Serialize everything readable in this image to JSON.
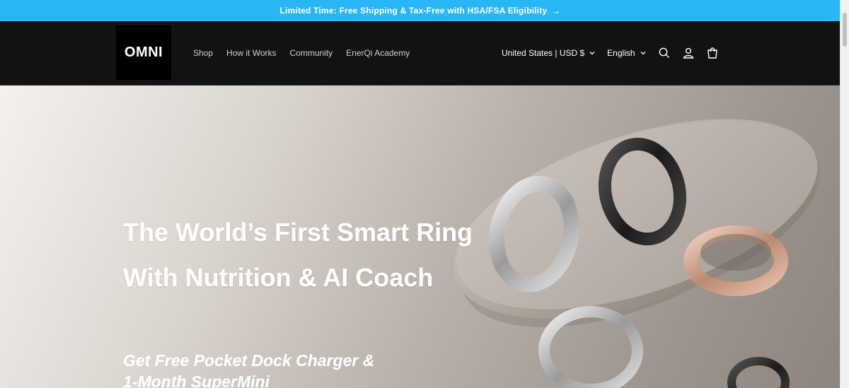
{
  "announcement": {
    "text": "Limited Time: Free Shipping & Tax-Free with HSA/FSA Eligibility",
    "arrow": "→"
  },
  "header": {
    "logo": "OMNI",
    "nav": [
      "Shop",
      "How it Works",
      "Community",
      "EnerQi Academy"
    ],
    "region": "United States | USD $",
    "language": "English",
    "icons": [
      "search-icon",
      "account-icon",
      "cart-icon"
    ]
  },
  "hero": {
    "headline_1": "The World’s First Smart Ring",
    "headline_2": "With Nutrition & AI Coach",
    "sub_1": "Get Free Pocket Dock Charger &",
    "sub_2": "1-Month SuperMini"
  },
  "colors": {
    "announcement_bg": "#29b6f6",
    "header_bg": "#121212",
    "text_light": "#ffffff"
  }
}
